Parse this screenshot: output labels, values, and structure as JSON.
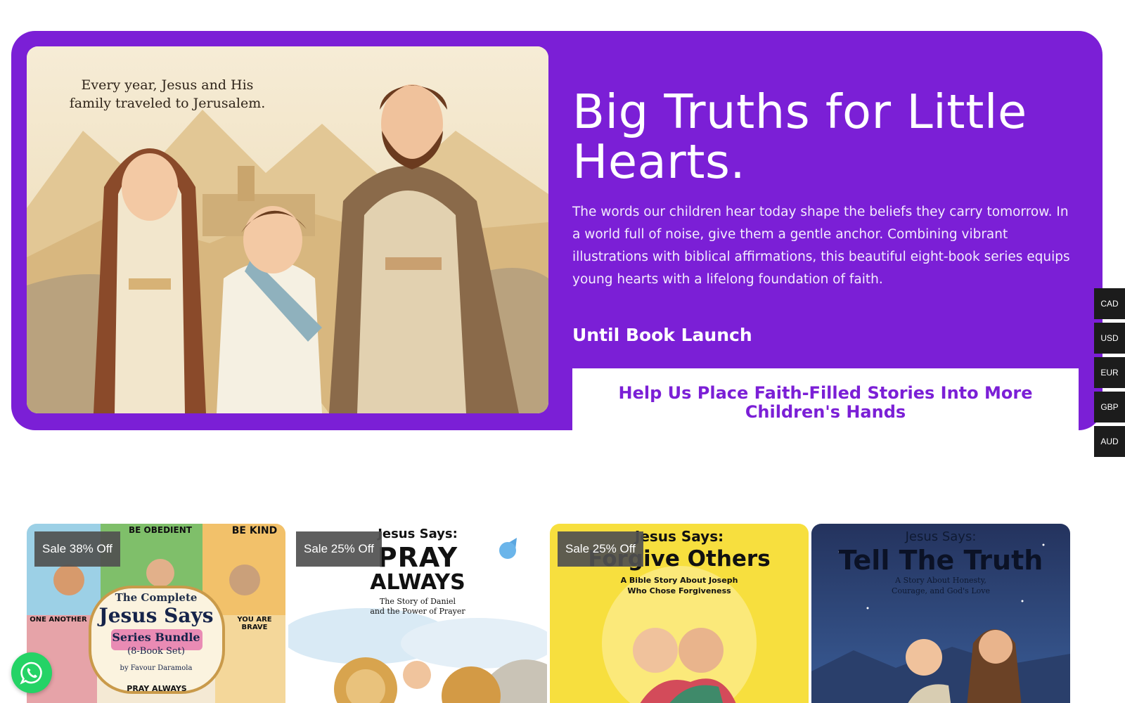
{
  "hero": {
    "image_caption": "Every year, Jesus and His family traveled to Jerusalem.",
    "title": "Big Truths for Little Hearts.",
    "description": "The words our children hear today shape the beliefs they carry tomorrow. In a world full of noise, give them a gentle anchor. Combining vibrant illustrations with biblical affirmations, this beautiful eight-book series equips young hearts with a lifelong foundation of faith.",
    "launch_label": "Until Book Launch",
    "cta_label": "Help Us Place Faith-Filled Stories Into More Children's Hands"
  },
  "currency": [
    "CAD",
    "USD",
    "EUR",
    "GBP",
    "AUD"
  ],
  "products": [
    {
      "badge": "Sale 38% Off",
      "cover_lines": [
        "The Complete",
        "Jesus Says",
        "Series Bundle",
        "(8-Book Set)",
        "by Favour Daramola"
      ],
      "mini_titles": [
        "BE OBEDIENT",
        "BE KIND",
        "ONE ANOTHER",
        "YOU ARE BRAVE",
        "PRAY ALWAYS"
      ]
    },
    {
      "badge": "Sale 25% Off",
      "cover_lines": [
        "Jesus Says:",
        "PRAY",
        "ALWAYS",
        "The Story of Daniel",
        "and the Power of Prayer"
      ]
    },
    {
      "badge": "Sale 25% Off",
      "cover_lines": [
        "Jesus Says:",
        "Forgive Others",
        "A Bible Story About Joseph",
        "Who Chose Forgiveness"
      ]
    },
    {
      "badge": "",
      "cover_lines": [
        "Jesus Says:",
        "Tell The Truth",
        "A Story About Honesty,",
        "Courage, and God's Love"
      ]
    }
  ],
  "colors": {
    "brand_purple": "#7b1fd6",
    "whatsapp_green": "#25d366",
    "badge_gray": "#505050"
  },
  "icons": {
    "whatsapp": "whatsapp-icon"
  }
}
